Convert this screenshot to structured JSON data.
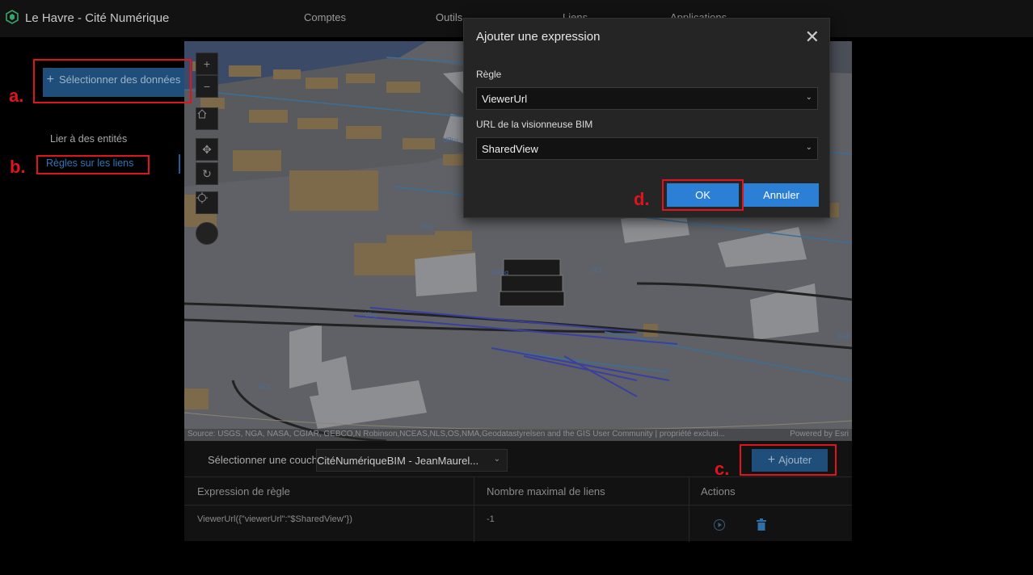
{
  "app": {
    "title": "Le Havre - Cité Numérique",
    "accent": "#2b7fd4"
  },
  "nav": {
    "items": [
      "Comptes",
      "Outils",
      "Liens",
      "Applications"
    ]
  },
  "sidebar": {
    "select_data_label": "Sélectionner des données",
    "items": [
      {
        "label": "Lier à des entités"
      },
      {
        "label": "Règles sur les liens"
      }
    ]
  },
  "map": {
    "labels": [
      "UPru",
      "ULg",
      "UGEg",
      "UCt",
      "ULg",
      "UCt",
      "UGE"
    ],
    "attribution_source": "Source: USGS, NGA, NASA, CGIAR, GEBCO,N Robinson,NCEAS,NLS,OS,NMA,Geodatastyrelsen and the GIS User Community | propriété exclusi...",
    "attribution_powered": "Powered by Esri"
  },
  "bottom": {
    "layer_label": "Sélectionner une couche",
    "layer_value": "CitéNumériqueBIM - JeanMaurel...",
    "add_label": "Ajouter",
    "columns": [
      "Expression de règle",
      "Nombre maximal de liens",
      "Actions"
    ],
    "rows": [
      {
        "expression": "ViewerUrl({\"viewerUrl\":\"$SharedView\"})",
        "max_links": "-1"
      }
    ]
  },
  "modal": {
    "title": "Ajouter une expression",
    "rule_label": "Règle",
    "rule_value": "ViewerUrl",
    "viewer_label": "URL de la visionneuse BIM",
    "viewer_value": "SharedView",
    "ok_label": "OK",
    "cancel_label": "Annuler"
  },
  "annotations": {
    "a": "a.",
    "b": "b.",
    "c": "c.",
    "d": "d.",
    "color": "#e0141e"
  }
}
